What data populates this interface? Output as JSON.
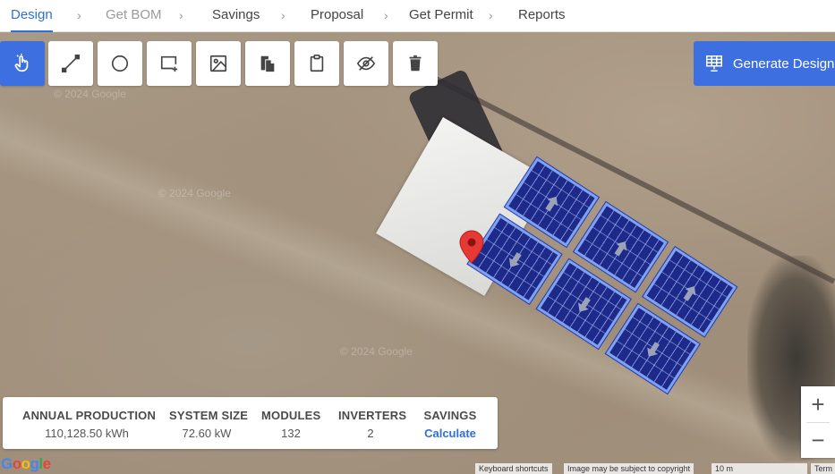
{
  "steps": [
    {
      "label": "Design",
      "state": "active"
    },
    {
      "label": "Get BOM",
      "state": "disabled"
    },
    {
      "label": "Savings",
      "state": "normal"
    },
    {
      "label": "Proposal",
      "state": "normal"
    },
    {
      "label": "Get Permit",
      "state": "normal"
    },
    {
      "label": "Reports",
      "state": "normal"
    }
  ],
  "toolbar": {
    "tools": [
      "select-hand-icon",
      "line-icon",
      "circle-icon",
      "add-rectangle-icon",
      "image-icon",
      "copy-icon",
      "clipboard-icon",
      "hide-icon",
      "trash-icon"
    ],
    "generate_label": "Generate Design"
  },
  "map": {
    "watermarks": [
      "© 2024 Google",
      "© 2024 Google",
      "© 2024 Google"
    ],
    "google_logo": "Google",
    "attribution": {
      "shortcuts": "Keyboard shortcuts",
      "copyright": "Image may be subject to copyright",
      "scale": "10 m",
      "terms": "Term"
    }
  },
  "stats": [
    {
      "label": "ANNUAL PRODUCTION",
      "value": "110,128.50 kWh"
    },
    {
      "label": "SYSTEM SIZE",
      "value": "72.60 kW"
    },
    {
      "label": "MODULES",
      "value": "132"
    },
    {
      "label": "INVERTERS",
      "value": "2"
    },
    {
      "label": "SAVINGS",
      "value": "Calculate"
    }
  ],
  "zoom": {
    "in": "+",
    "out": "−"
  },
  "colors": {
    "accent": "#3d6fe0",
    "panel": "#1d2a8a",
    "pin": "#e53935"
  }
}
